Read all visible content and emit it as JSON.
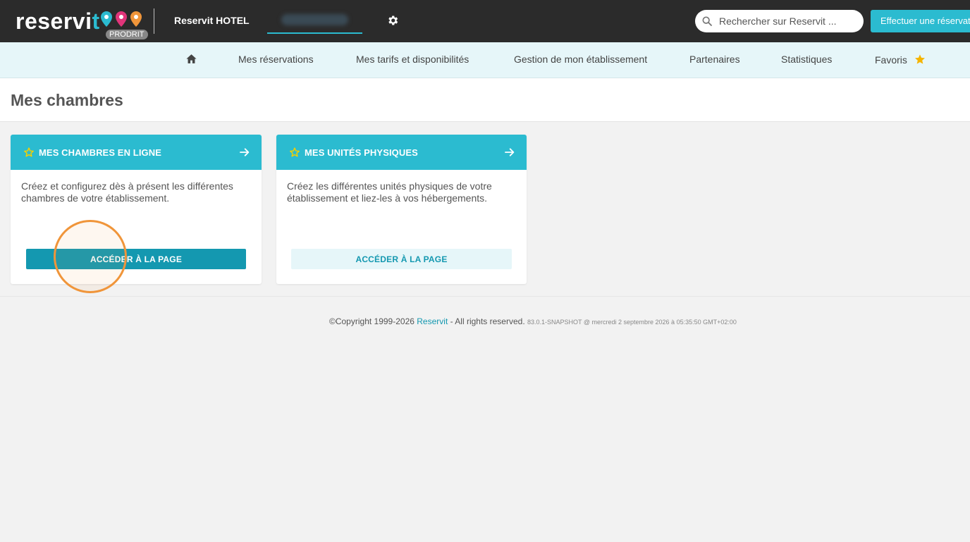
{
  "topbar": {
    "logo_text_start": "reservi",
    "logo_text_end": "t",
    "env_badge": "PRODRIT",
    "hotel_name": "Reservit HOTEL",
    "search_placeholder": "Rechercher sur Reservit ...",
    "cta_label": "Effectuer une réservation"
  },
  "nav": {
    "items": [
      "Mes réservations",
      "Mes tarifs et disponibilités",
      "Gestion de mon établissement",
      "Partenaires",
      "Statistiques",
      "Favoris"
    ]
  },
  "page": {
    "title": "Mes chambres"
  },
  "cards": [
    {
      "title": "MES CHAMBRES EN LIGNE",
      "description": "Créez et configurez dès à présent les différentes chambres de votre établissement.",
      "button": "ACCÉDER À LA PAGE"
    },
    {
      "title": "MES UNITÉS PHYSIQUES",
      "description": "Créez les différentes unités physiques de votre établissement et liez-les à vos hébergements.",
      "button": "ACCÉDER À LA PAGE"
    }
  ],
  "footer": {
    "copyright": "©Copyright 1999-2026 ",
    "brand": "Reservit",
    "rights": " - All rights reserved. ",
    "version": "83.0.1-SNAPSHOT @ mercredi 2 septembre 2026 à 05:35:50 GMT+02:00"
  },
  "colors": {
    "accent": "#2bbbd0",
    "accent_dark": "#1498b0",
    "topbar": "#2b2b2b",
    "navbar": "#e6f6f9",
    "highlight": "#f0953a",
    "favorite_star": "#f5b400"
  },
  "icons": [
    "home-icon",
    "gear-icon",
    "search-icon",
    "star-outline-icon",
    "arrow-right-icon",
    "star-filled-icon"
  ]
}
